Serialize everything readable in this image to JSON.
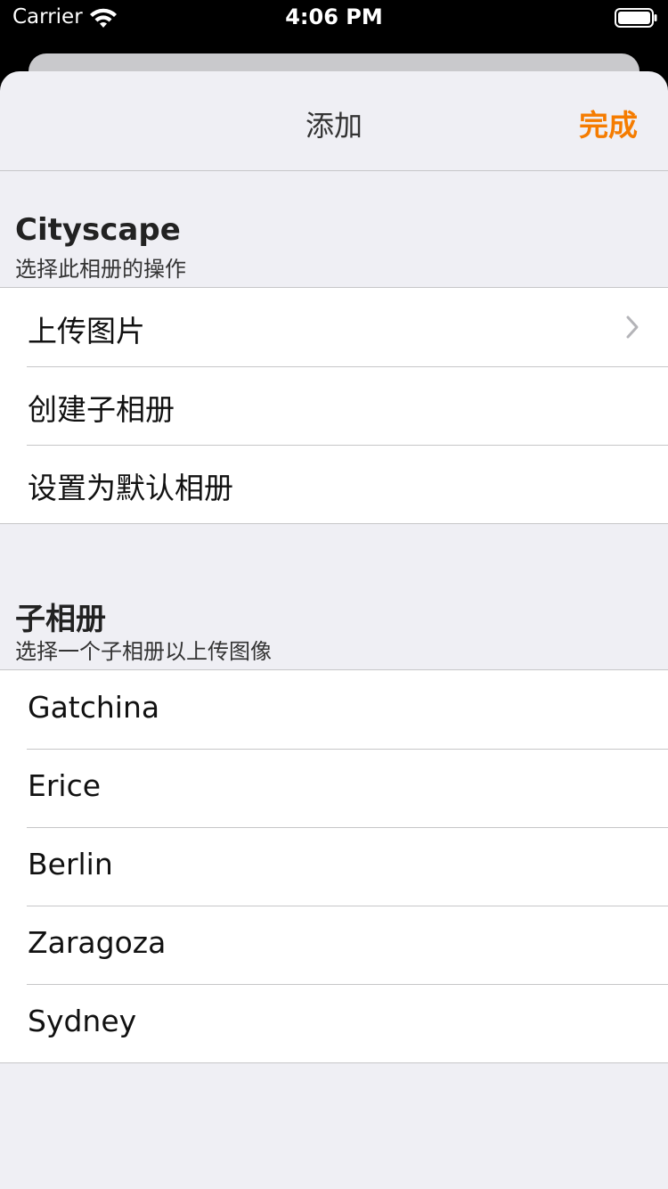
{
  "status_bar": {
    "carrier": "Carrier",
    "time": "4:06 PM"
  },
  "nav": {
    "title": "添加",
    "done_label": "完成",
    "accent_color": "#f57c00"
  },
  "album_section": {
    "title": "Cityscape",
    "subtitle": "选择此相册的操作",
    "actions": [
      {
        "label": "上传图片",
        "has_chevron": true
      },
      {
        "label": "创建子相册"
      },
      {
        "label": "设置为默认相册"
      }
    ]
  },
  "subalbum_section": {
    "title": "子相册",
    "subtitle": "选择一个子相册以上传图像",
    "albums": [
      {
        "label": "Gatchina"
      },
      {
        "label": "Erice"
      },
      {
        "label": "Berlin"
      },
      {
        "label": "Zaragoza"
      },
      {
        "label": "Sydney"
      }
    ]
  }
}
